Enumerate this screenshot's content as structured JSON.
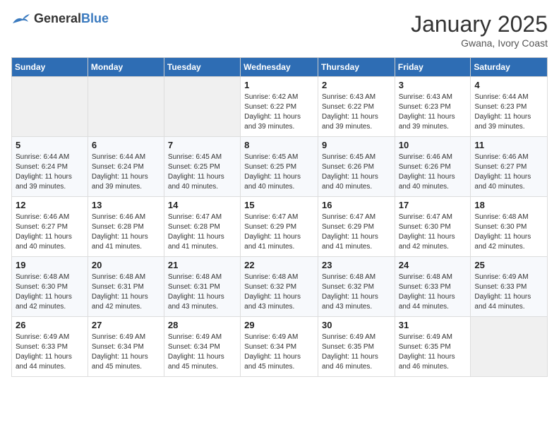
{
  "header": {
    "logo_general": "General",
    "logo_blue": "Blue",
    "month_year": "January 2025",
    "location": "Gwana, Ivory Coast"
  },
  "days_of_week": [
    "Sunday",
    "Monday",
    "Tuesday",
    "Wednesday",
    "Thursday",
    "Friday",
    "Saturday"
  ],
  "weeks": [
    [
      {
        "day": null
      },
      {
        "day": null
      },
      {
        "day": null
      },
      {
        "day": "1",
        "sunrise": "6:42 AM",
        "sunset": "6:22 PM",
        "daylight": "11 hours and 39 minutes."
      },
      {
        "day": "2",
        "sunrise": "6:43 AM",
        "sunset": "6:22 PM",
        "daylight": "11 hours and 39 minutes."
      },
      {
        "day": "3",
        "sunrise": "6:43 AM",
        "sunset": "6:23 PM",
        "daylight": "11 hours and 39 minutes."
      },
      {
        "day": "4",
        "sunrise": "6:44 AM",
        "sunset": "6:23 PM",
        "daylight": "11 hours and 39 minutes."
      }
    ],
    [
      {
        "day": "5",
        "sunrise": "6:44 AM",
        "sunset": "6:24 PM",
        "daylight": "11 hours and 39 minutes."
      },
      {
        "day": "6",
        "sunrise": "6:44 AM",
        "sunset": "6:24 PM",
        "daylight": "11 hours and 39 minutes."
      },
      {
        "day": "7",
        "sunrise": "6:45 AM",
        "sunset": "6:25 PM",
        "daylight": "11 hours and 40 minutes."
      },
      {
        "day": "8",
        "sunrise": "6:45 AM",
        "sunset": "6:25 PM",
        "daylight": "11 hours and 40 minutes."
      },
      {
        "day": "9",
        "sunrise": "6:45 AM",
        "sunset": "6:26 PM",
        "daylight": "11 hours and 40 minutes."
      },
      {
        "day": "10",
        "sunrise": "6:46 AM",
        "sunset": "6:26 PM",
        "daylight": "11 hours and 40 minutes."
      },
      {
        "day": "11",
        "sunrise": "6:46 AM",
        "sunset": "6:27 PM",
        "daylight": "11 hours and 40 minutes."
      }
    ],
    [
      {
        "day": "12",
        "sunrise": "6:46 AM",
        "sunset": "6:27 PM",
        "daylight": "11 hours and 40 minutes."
      },
      {
        "day": "13",
        "sunrise": "6:46 AM",
        "sunset": "6:28 PM",
        "daylight": "11 hours and 41 minutes."
      },
      {
        "day": "14",
        "sunrise": "6:47 AM",
        "sunset": "6:28 PM",
        "daylight": "11 hours and 41 minutes."
      },
      {
        "day": "15",
        "sunrise": "6:47 AM",
        "sunset": "6:29 PM",
        "daylight": "11 hours and 41 minutes."
      },
      {
        "day": "16",
        "sunrise": "6:47 AM",
        "sunset": "6:29 PM",
        "daylight": "11 hours and 41 minutes."
      },
      {
        "day": "17",
        "sunrise": "6:47 AM",
        "sunset": "6:30 PM",
        "daylight": "11 hours and 42 minutes."
      },
      {
        "day": "18",
        "sunrise": "6:48 AM",
        "sunset": "6:30 PM",
        "daylight": "11 hours and 42 minutes."
      }
    ],
    [
      {
        "day": "19",
        "sunrise": "6:48 AM",
        "sunset": "6:30 PM",
        "daylight": "11 hours and 42 minutes."
      },
      {
        "day": "20",
        "sunrise": "6:48 AM",
        "sunset": "6:31 PM",
        "daylight": "11 hours and 42 minutes."
      },
      {
        "day": "21",
        "sunrise": "6:48 AM",
        "sunset": "6:31 PM",
        "daylight": "11 hours and 43 minutes."
      },
      {
        "day": "22",
        "sunrise": "6:48 AM",
        "sunset": "6:32 PM",
        "daylight": "11 hours and 43 minutes."
      },
      {
        "day": "23",
        "sunrise": "6:48 AM",
        "sunset": "6:32 PM",
        "daylight": "11 hours and 43 minutes."
      },
      {
        "day": "24",
        "sunrise": "6:48 AM",
        "sunset": "6:33 PM",
        "daylight": "11 hours and 44 minutes."
      },
      {
        "day": "25",
        "sunrise": "6:49 AM",
        "sunset": "6:33 PM",
        "daylight": "11 hours and 44 minutes."
      }
    ],
    [
      {
        "day": "26",
        "sunrise": "6:49 AM",
        "sunset": "6:33 PM",
        "daylight": "11 hours and 44 minutes."
      },
      {
        "day": "27",
        "sunrise": "6:49 AM",
        "sunset": "6:34 PM",
        "daylight": "11 hours and 45 minutes."
      },
      {
        "day": "28",
        "sunrise": "6:49 AM",
        "sunset": "6:34 PM",
        "daylight": "11 hours and 45 minutes."
      },
      {
        "day": "29",
        "sunrise": "6:49 AM",
        "sunset": "6:34 PM",
        "daylight": "11 hours and 45 minutes."
      },
      {
        "day": "30",
        "sunrise": "6:49 AM",
        "sunset": "6:35 PM",
        "daylight": "11 hours and 46 minutes."
      },
      {
        "day": "31",
        "sunrise": "6:49 AM",
        "sunset": "6:35 PM",
        "daylight": "11 hours and 46 minutes."
      },
      {
        "day": null
      }
    ]
  ],
  "labels": {
    "sunrise_prefix": "Sunrise: ",
    "sunset_prefix": "Sunset: ",
    "daylight_prefix": "Daylight: "
  }
}
